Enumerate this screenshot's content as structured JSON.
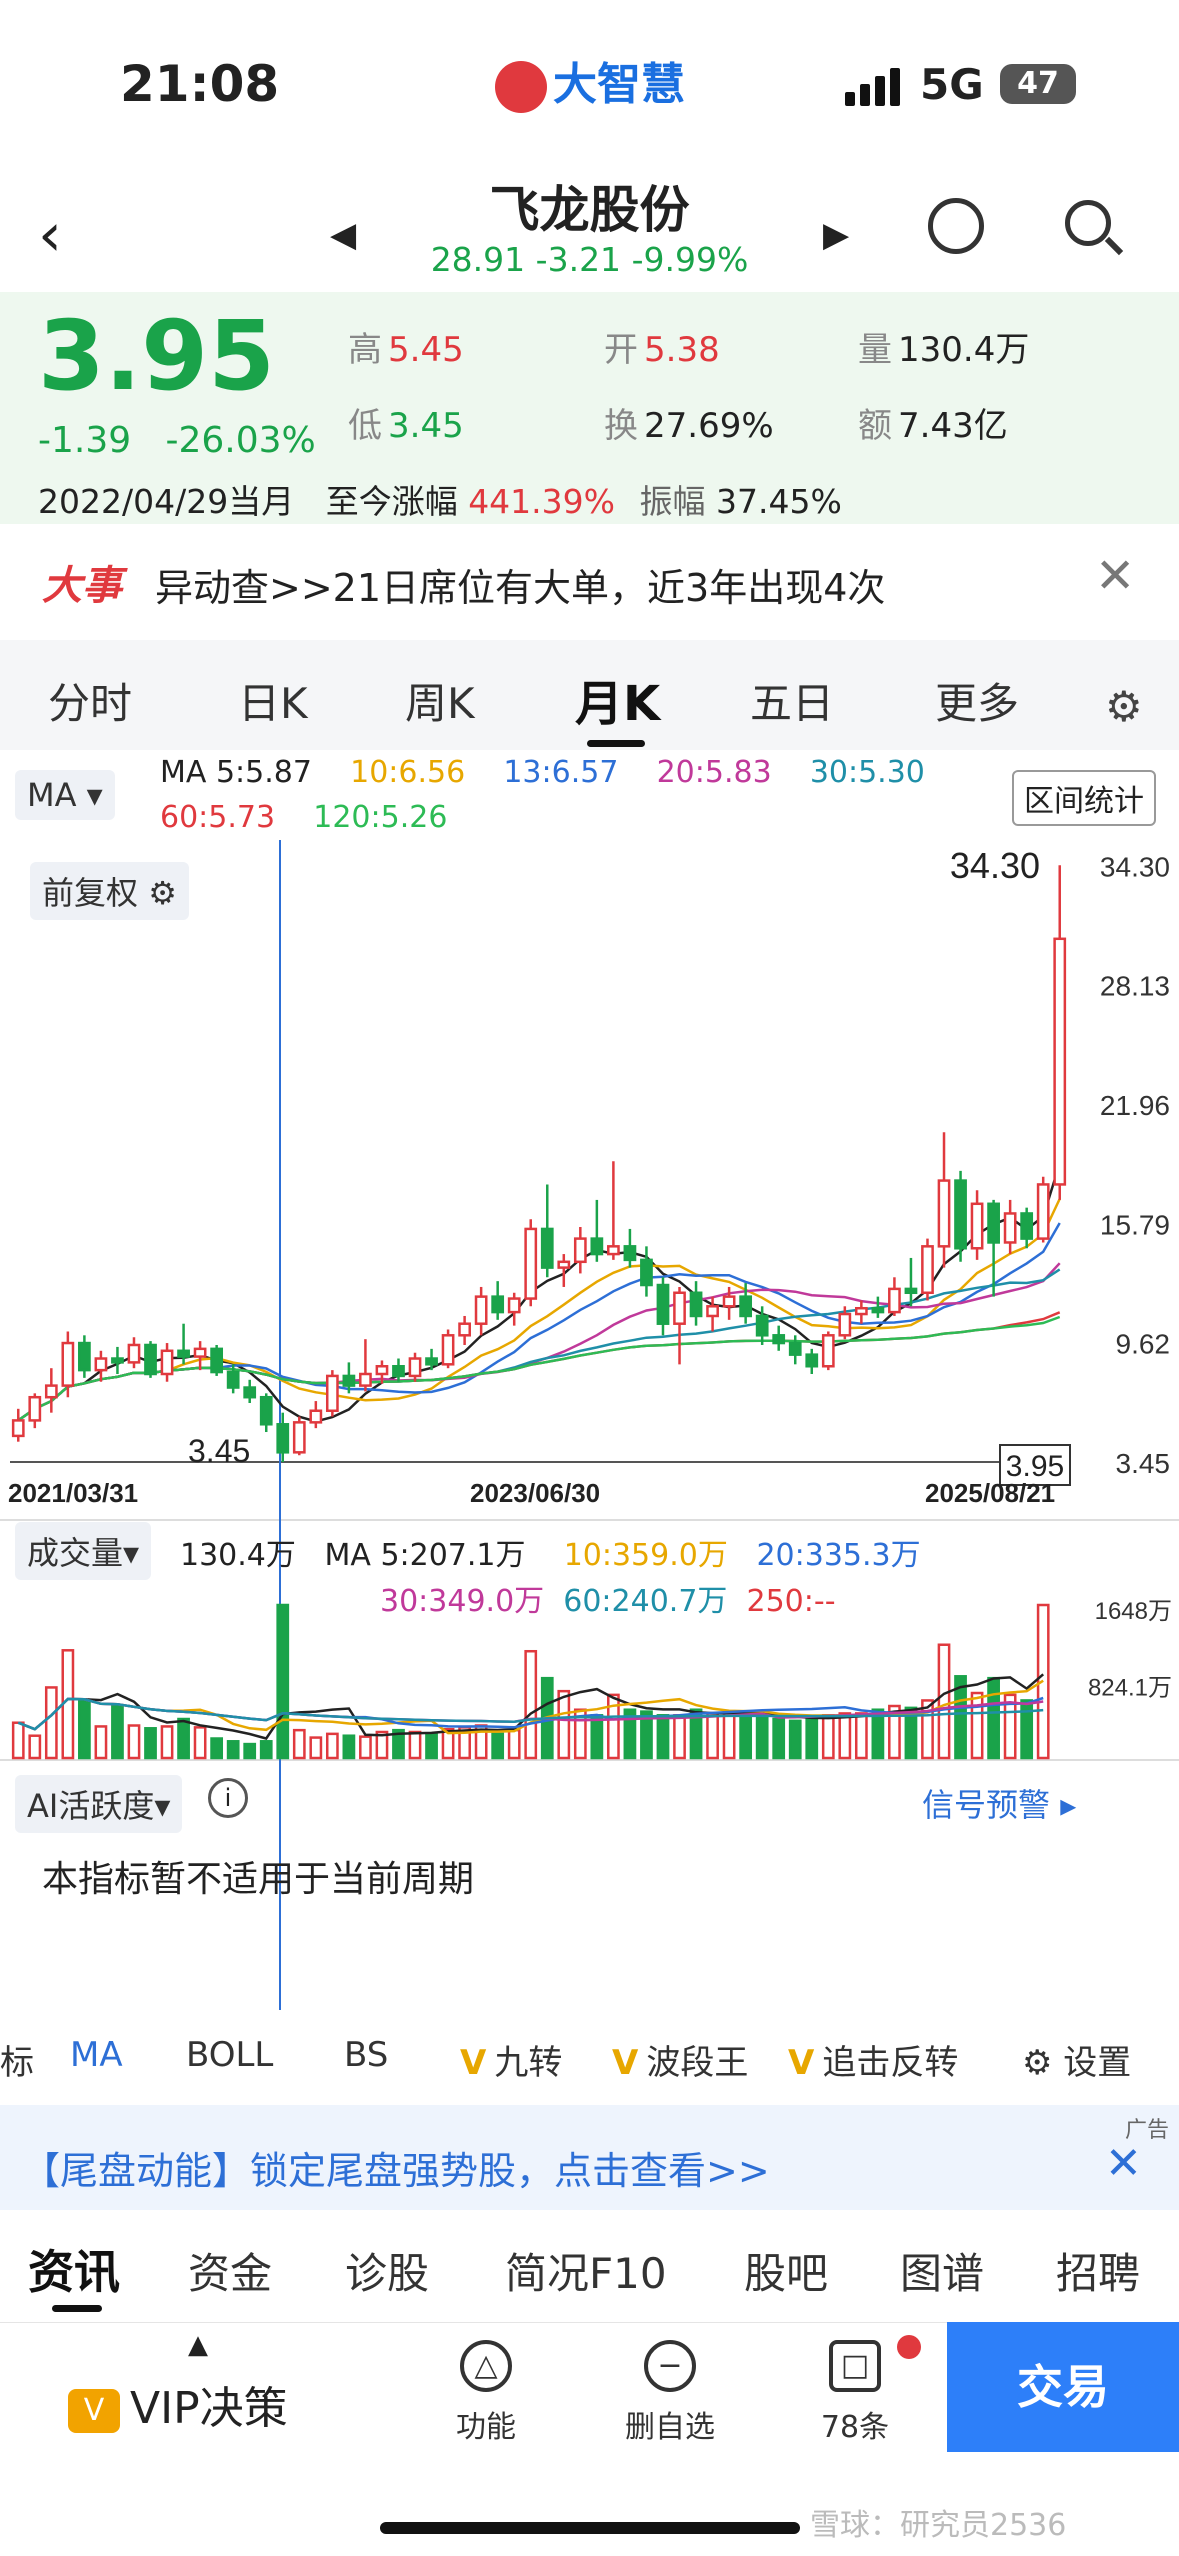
{
  "status": {
    "time": "21:08",
    "app_logo": "大智慧",
    "network": "5G",
    "battery": "47"
  },
  "header": {
    "stock_name": "飞龙股份",
    "index_price": "28.91",
    "index_change": "-3.21",
    "index_pct": "-9.99%"
  },
  "quote": {
    "price": "3.95",
    "change": "-1.39",
    "change_pct": "-26.03%",
    "high_label": "高",
    "high": "5.45",
    "low_label": "低",
    "low": "3.45",
    "open_label": "开",
    "open": "5.38",
    "turnover_label": "换",
    "turnover": "27.69%",
    "volume_label": "量",
    "volume": "130.4万",
    "amount_label": "额",
    "amount": "7.43亿",
    "date": "2022/04/29当月",
    "since_label": "至今涨幅",
    "since_value": "441.39%",
    "amplitude_label": "振幅",
    "amplitude": "37.45%"
  },
  "news": {
    "tag": "大事",
    "text": "异动查>>21日席位有大单，近3年出现4次"
  },
  "tabs": [
    "分时",
    "日K",
    "周K",
    "月K",
    "五日",
    "更多"
  ],
  "chart": {
    "ma_selector": "MA",
    "ma_label": "MA",
    "ma": [
      {
        "text": "5:5.87",
        "color": "#222222"
      },
      {
        "text": "10:6.56",
        "color": "#e7a700"
      },
      {
        "text": "13:6.57",
        "color": "#2d6fd6"
      },
      {
        "text": "20:5.83",
        "color": "#c0399a"
      },
      {
        "text": "30:5.30",
        "color": "#1f8fa8"
      },
      {
        "text": "60:5.73",
        "color": "#e0393e"
      },
      {
        "text": "120:5.26",
        "color": "#2dbb55"
      }
    ],
    "range_button": "区间统计",
    "fq": "前复权",
    "price_axis": [
      "34.30",
      "28.13",
      "21.96",
      "15.79",
      "9.62",
      "3.45"
    ],
    "high_mark": "34.30",
    "low_mark": "3.45",
    "current_mark": "3.95",
    "dates": [
      "2021/03/31",
      "2023/06/30",
      "2025/08/21"
    ],
    "volume": {
      "selector": "成交量",
      "current": "130.4万",
      "ma": [
        {
          "text": "MA 5:207.1万",
          "color": "#222222"
        },
        {
          "text": "10:359.0万",
          "color": "#e7a700"
        },
        {
          "text": "20:335.3万",
          "color": "#2d6fd6"
        },
        {
          "text": "30:349.0万",
          "color": "#c0399a"
        },
        {
          "text": "60:240.7万",
          "color": "#1f8fa8"
        },
        {
          "text": "250:--",
          "color": "#e0393e"
        }
      ],
      "axis": [
        "1648万",
        "824.1万"
      ]
    },
    "ai": {
      "selector": "AI活跃度",
      "signal": "信号预警",
      "message": "本指标暂不适用于当前周期"
    }
  },
  "chart_data": {
    "type": "candlestick",
    "x_start": "2021/03/31",
    "x_end": "2025/08/21",
    "ylim": [
      3.45,
      34.3
    ],
    "candles": [
      {
        "o": 4.8,
        "h": 6.2,
        "l": 4.5,
        "c": 5.6
      },
      {
        "o": 5.6,
        "h": 7.0,
        "l": 5.2,
        "c": 6.8
      },
      {
        "o": 6.8,
        "h": 8.3,
        "l": 6.0,
        "c": 7.4
      },
      {
        "o": 7.4,
        "h": 10.2,
        "l": 6.8,
        "c": 9.6
      },
      {
        "o": 9.6,
        "h": 10.0,
        "l": 7.8,
        "c": 8.2
      },
      {
        "o": 8.2,
        "h": 9.2,
        "l": 7.6,
        "c": 8.8
      },
      {
        "o": 8.8,
        "h": 9.4,
        "l": 8.0,
        "c": 8.6
      },
      {
        "o": 8.6,
        "h": 9.9,
        "l": 8.3,
        "c": 9.5
      },
      {
        "o": 9.5,
        "h": 9.7,
        "l": 7.8,
        "c": 8.0
      },
      {
        "o": 8.0,
        "h": 9.6,
        "l": 7.6,
        "c": 9.2
      },
      {
        "o": 9.2,
        "h": 10.6,
        "l": 8.5,
        "c": 8.9
      },
      {
        "o": 8.9,
        "h": 9.7,
        "l": 8.2,
        "c": 9.3
      },
      {
        "o": 9.3,
        "h": 9.5,
        "l": 7.9,
        "c": 8.1
      },
      {
        "o": 8.1,
        "h": 8.5,
        "l": 7.0,
        "c": 7.3
      },
      {
        "o": 7.3,
        "h": 7.7,
        "l": 6.5,
        "c": 6.8
      },
      {
        "o": 6.8,
        "h": 7.0,
        "l": 5.0,
        "c": 5.4
      },
      {
        "o": 5.4,
        "h": 6.0,
        "l": 3.45,
        "c": 3.95
      },
      {
        "o": 3.95,
        "h": 5.8,
        "l": 3.8,
        "c": 5.5
      },
      {
        "o": 5.5,
        "h": 6.6,
        "l": 5.2,
        "c": 6.1
      },
      {
        "o": 6.1,
        "h": 8.2,
        "l": 5.8,
        "c": 7.9
      },
      {
        "o": 7.9,
        "h": 8.6,
        "l": 7.0,
        "c": 7.4
      },
      {
        "o": 7.4,
        "h": 9.8,
        "l": 7.1,
        "c": 8.0
      },
      {
        "o": 8.0,
        "h": 8.7,
        "l": 7.5,
        "c": 8.4
      },
      {
        "o": 8.4,
        "h": 8.8,
        "l": 7.6,
        "c": 7.9
      },
      {
        "o": 7.9,
        "h": 9.1,
        "l": 7.6,
        "c": 8.8
      },
      {
        "o": 8.8,
        "h": 9.3,
        "l": 8.2,
        "c": 8.5
      },
      {
        "o": 8.5,
        "h": 10.3,
        "l": 8.3,
        "c": 10.0
      },
      {
        "o": 10.0,
        "h": 11.0,
        "l": 9.5,
        "c": 10.6
      },
      {
        "o": 10.6,
        "h": 12.5,
        "l": 10.0,
        "c": 12.0
      },
      {
        "o": 12.0,
        "h": 12.8,
        "l": 10.8,
        "c": 11.2
      },
      {
        "o": 11.2,
        "h": 12.2,
        "l": 10.5,
        "c": 11.9
      },
      {
        "o": 11.9,
        "h": 16.0,
        "l": 11.5,
        "c": 15.5
      },
      {
        "o": 15.5,
        "h": 17.8,
        "l": 13.0,
        "c": 13.5
      },
      {
        "o": 13.5,
        "h": 14.2,
        "l": 12.5,
        "c": 13.8
      },
      {
        "o": 13.8,
        "h": 15.6,
        "l": 13.2,
        "c": 15.0
      },
      {
        "o": 15.0,
        "h": 17.0,
        "l": 13.8,
        "c": 14.2
      },
      {
        "o": 14.2,
        "h": 19.0,
        "l": 13.9,
        "c": 14.6
      },
      {
        "o": 14.6,
        "h": 15.5,
        "l": 13.5,
        "c": 13.9
      },
      {
        "o": 13.9,
        "h": 14.6,
        "l": 12.0,
        "c": 12.6
      },
      {
        "o": 12.6,
        "h": 13.0,
        "l": 10.0,
        "c": 10.6
      },
      {
        "o": 10.6,
        "h": 12.5,
        "l": 8.5,
        "c": 12.2
      },
      {
        "o": 12.2,
        "h": 12.8,
        "l": 10.5,
        "c": 11.0
      },
      {
        "o": 11.0,
        "h": 12.0,
        "l": 10.2,
        "c": 11.5
      },
      {
        "o": 11.5,
        "h": 12.5,
        "l": 10.8,
        "c": 12.0
      },
      {
        "o": 12.0,
        "h": 12.7,
        "l": 10.6,
        "c": 11.0
      },
      {
        "o": 11.0,
        "h": 11.5,
        "l": 9.5,
        "c": 10.0
      },
      {
        "o": 10.0,
        "h": 10.5,
        "l": 9.2,
        "c": 9.6
      },
      {
        "o": 9.6,
        "h": 10.0,
        "l": 8.5,
        "c": 9.0
      },
      {
        "o": 9.0,
        "h": 9.3,
        "l": 8.0,
        "c": 8.4
      },
      {
        "o": 8.4,
        "h": 10.2,
        "l": 8.2,
        "c": 10.0
      },
      {
        "o": 10.0,
        "h": 11.5,
        "l": 9.8,
        "c": 11.1
      },
      {
        "o": 11.1,
        "h": 11.8,
        "l": 10.6,
        "c": 11.4
      },
      {
        "o": 11.4,
        "h": 12.0,
        "l": 10.9,
        "c": 11.2
      },
      {
        "o": 11.2,
        "h": 13.0,
        "l": 11.0,
        "c": 12.4
      },
      {
        "o": 12.4,
        "h": 14.0,
        "l": 11.5,
        "c": 12.2
      },
      {
        "o": 12.2,
        "h": 15.0,
        "l": 11.8,
        "c": 14.6
      },
      {
        "o": 14.6,
        "h": 20.5,
        "l": 13.5,
        "c": 18.0
      },
      {
        "o": 18.0,
        "h": 18.5,
        "l": 13.8,
        "c": 14.5
      },
      {
        "o": 14.5,
        "h": 17.5,
        "l": 13.9,
        "c": 16.8
      },
      {
        "o": 16.8,
        "h": 17.0,
        "l": 12.0,
        "c": 14.8
      },
      {
        "o": 14.8,
        "h": 17.0,
        "l": 14.2,
        "c": 16.3
      },
      {
        "o": 16.3,
        "h": 16.6,
        "l": 14.5,
        "c": 15.0
      },
      {
        "o": 15.0,
        "h": 18.2,
        "l": 14.8,
        "c": 17.8
      },
      {
        "o": 17.8,
        "h": 34.3,
        "l": 17.0,
        "c": 30.5
      }
    ],
    "volumes": [
      380,
      240,
      760,
      1160,
      620,
      340,
      560,
      350,
      320,
      340,
      420,
      330,
      210,
      180,
      150,
      180,
      1648,
      300,
      220,
      260,
      240,
      230,
      280,
      300,
      280,
      260,
      310,
      330,
      350,
      260,
      300,
      1150,
      860,
      720,
      520,
      460,
      680,
      520,
      500,
      460,
      460,
      520,
      480,
      500,
      470,
      440,
      420,
      400,
      430,
      460,
      480,
      480,
      520,
      560,
      540,
      620,
      1220,
      880,
      700,
      860,
      680,
      620,
      1648
    ]
  },
  "indicators": [
    "标",
    "MA",
    "BOLL",
    "BS",
    "九转",
    "波段王",
    "追击反转",
    "设置"
  ],
  "ad": {
    "label": "广告",
    "text": "【尾盘动能】锁定尾盘强势股，点击查看>>"
  },
  "info_tabs": [
    "资讯",
    "资金",
    "诊股",
    "简况F10",
    "股吧",
    "图谱",
    "招聘"
  ],
  "bottom": {
    "vip": "VIP决策",
    "function": "功能",
    "remove": "删自选",
    "messages": "78条",
    "trade": "交易"
  },
  "watermark": "雪球：研究员2536"
}
